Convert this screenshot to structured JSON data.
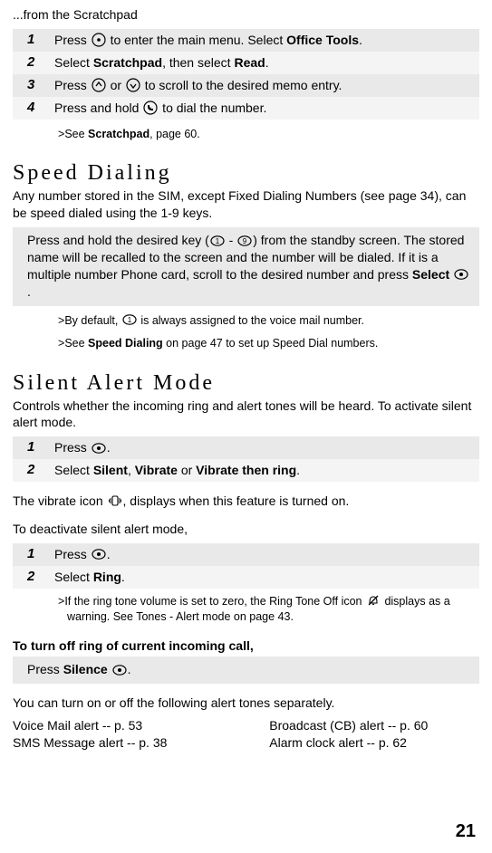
{
  "topline": "...from the Scratchpad",
  "scratchpad_steps": {
    "s1_a": "Press ",
    "s1_b": " to enter the main menu. Select ",
    "s1_c": "Office Tools",
    "s1_d": ".",
    "s2_a": "Select ",
    "s2_b": "Scratchpad",
    "s2_c": ", then select ",
    "s2_d": "Read",
    "s2_e": ".",
    "s3_a": "Press ",
    "s3_b": " or ",
    "s3_c": " to scroll to the desired memo entry.",
    "s4_a": "Press and hold ",
    "s4_b": " to dial the number."
  },
  "scratch_note_a": ">",
  "scratch_note_b": "See ",
  "scratch_note_c": "Scratchpad",
  "scratch_note_d": ", page 60.",
  "speed_h": "Speed Dialing",
  "speed_para": "Any number stored in the SIM, except Fixed Dialing Numbers (see page 34), can be speed dialed using the 1-9 keys.",
  "speed_box_a": "Press and hold the desired key (",
  "speed_box_b": " - ",
  "speed_box_c": ") from the standby screen. The stored name will be recalled to the screen and the number will be dialed. If it is a multiple number Phone card, scroll to the desired number and press ",
  "speed_box_d": "Select",
  "speed_box_e": " ",
  "speed_box_f": ".",
  "speed_note1_a": ">",
  "speed_note1_b": "By default, ",
  "speed_note1_c": " is always assigned to the voice mail number.",
  "speed_note2_a": ">",
  "speed_note2_b": "See ",
  "speed_note2_c": "Speed Dialing",
  "speed_note2_d": " on page 47 to set up Speed Dial numbers.",
  "silent_h": "Silent Alert Mode",
  "silent_para": "Controls whether the incoming ring and alert tones will be heard. To activate silent alert mode.",
  "silent_on": {
    "s1_a": "Press ",
    "s1_b": ".",
    "s2_a": "Select  ",
    "s2_b": "Silent",
    "s2_c": ", ",
    "s2_d": "Vibrate",
    "s2_e": " or ",
    "s2_f": "Vibrate then ring",
    "s2_g": "."
  },
  "vibrate_para_a": "The vibrate icon ",
  "vibrate_para_b": ", displays when this feature is turned on.",
  "deact_para": "To deactivate silent alert mode,",
  "silent_off": {
    "s1_a": "Press ",
    "s1_b": ".",
    "s2_a": "Select ",
    "s2_b": "Ring",
    "s2_c": "."
  },
  "ring_note_a": ">",
  "ring_note_b": "If the ring tone volume is set to zero, the Ring Tone Off icon ",
  "ring_note_c": " displays as a warning.  See Tones - Alert mode on page 43.",
  "turnoff_h": "To turn off ring of current incoming call,",
  "turnoff_box_a": "Press  ",
  "turnoff_box_b": "Silence",
  "turnoff_box_c": " ",
  "turnoff_box_d": ".",
  "sep_para": "You can turn on or off the following alert tones separately.",
  "col_l1": "Voice Mail alert -- p. 53",
  "col_l2": "SMS Message alert -- p. 38",
  "col_r1": "Broadcast (CB) alert -- p. 60",
  "col_r2": "Alarm clock alert -- p. 62",
  "pagenum": "21",
  "n1": "1",
  "n2": "2",
  "n3": "3",
  "n4": "4"
}
